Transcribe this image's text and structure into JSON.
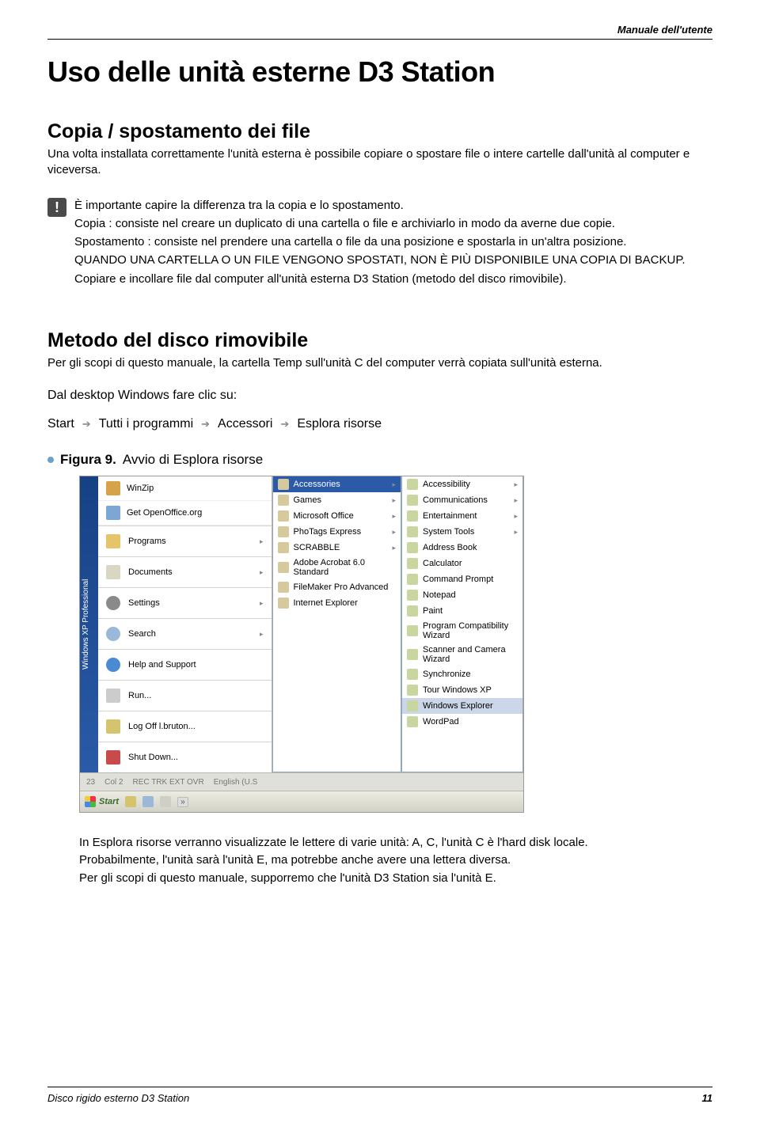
{
  "header": {
    "manual": "Manuale dell'utente"
  },
  "title": "Uso delle unità esterne D3 Station",
  "section1": {
    "heading": "Copia / spostamento dei file",
    "intro": "Una volta installata correttamente l'unità esterna è possibile copiare o spostare file o intere cartelle dall'unità al computer e viceversa."
  },
  "alert": {
    "p1": "È importante capire la differenza tra la copia e lo spostamento.",
    "p2": "Copia : consiste nel creare un duplicato di una cartella o file e archiviarlo in modo da averne due copie.",
    "p3": "Spostamento : consiste nel prendere una cartella o file da una posizione e spostarla in un'altra posizione.",
    "p4": "QUANDO UNA CARTELLA O UN FILE VENGONO SPOSTATI, NON È PIÙ DISPONIBILE UNA COPIA DI BACKUP.",
    "p5": "Copiare e incollare file dal computer all'unità esterna D3 Station (metodo del disco rimovibile)."
  },
  "section2": {
    "heading": "Metodo del disco rimovibile",
    "intro": "Per gli scopi di questo manuale, la cartella Temp sull'unità C del computer verrà copiata sull'unità esterna.",
    "desktop_note": "Dal desktop Windows fare clic su:",
    "path": {
      "a": "Start",
      "b": "Tutti i programmi",
      "c": "Accessori",
      "d": "Esplora risorse"
    }
  },
  "figure": {
    "label": "Figura 9.",
    "caption": "Avvio di Esplora risorse"
  },
  "screenshot": {
    "os_label": "Windows XP Professional",
    "start_items_top": [
      {
        "label": "WinZip"
      },
      {
        "label": "Get OpenOffice.org"
      }
    ],
    "start_items": [
      {
        "label": "Programs",
        "icon": "folder",
        "arrow": true
      },
      {
        "label": "Documents",
        "icon": "doc",
        "arrow": true
      },
      {
        "label": "Settings",
        "icon": "gear",
        "arrow": true
      },
      {
        "label": "Search",
        "icon": "search",
        "arrow": true
      },
      {
        "label": "Help and Support",
        "icon": "help",
        "arrow": false
      },
      {
        "label": "Run...",
        "icon": "run",
        "arrow": false
      },
      {
        "label": "Log Off l.bruton...",
        "icon": "key",
        "arrow": false
      },
      {
        "label": "Shut Down...",
        "icon": "power",
        "arrow": false
      }
    ],
    "programs_menu": [
      "Accessories",
      "Games",
      "Microsoft Office",
      "PhoTags Express",
      "SCRABBLE",
      "Adobe Acrobat 6.0 Standard",
      "FileMaker Pro Advanced",
      "Internet Explorer"
    ],
    "accessories_menu": [
      "Accessibility",
      "Communications",
      "Entertainment",
      "System Tools",
      "Address Book",
      "Calculator",
      "Command Prompt",
      "Notepad",
      "Paint",
      "Program Compatibility Wizard",
      "Scanner and Camera Wizard",
      "Synchronize",
      "Tour Windows XP",
      "Windows Explorer",
      "WordPad"
    ],
    "accessories_selected": "Windows Explorer",
    "programs_highlighted": "Accessories",
    "status": {
      "ln": "23",
      "col": "Col 2",
      "flags": "REC  TRK  EXT  OVR",
      "lang": "English (U.S"
    },
    "taskbar": {
      "start": "Start",
      "expand": "»"
    }
  },
  "after": {
    "p1": "In Esplora risorse verranno visualizzate le lettere di varie unità: A, C, l'unità C è l'hard disk locale.",
    "p2": "Probabilmente, l'unità sarà l'unità E, ma potrebbe anche avere una lettera diversa.",
    "p3": "Per gli scopi di questo manuale, supporremo che l'unità D3 Station sia l'unità E."
  },
  "footer": {
    "left": "Disco rigido esterno D3 Station",
    "right": "11"
  }
}
